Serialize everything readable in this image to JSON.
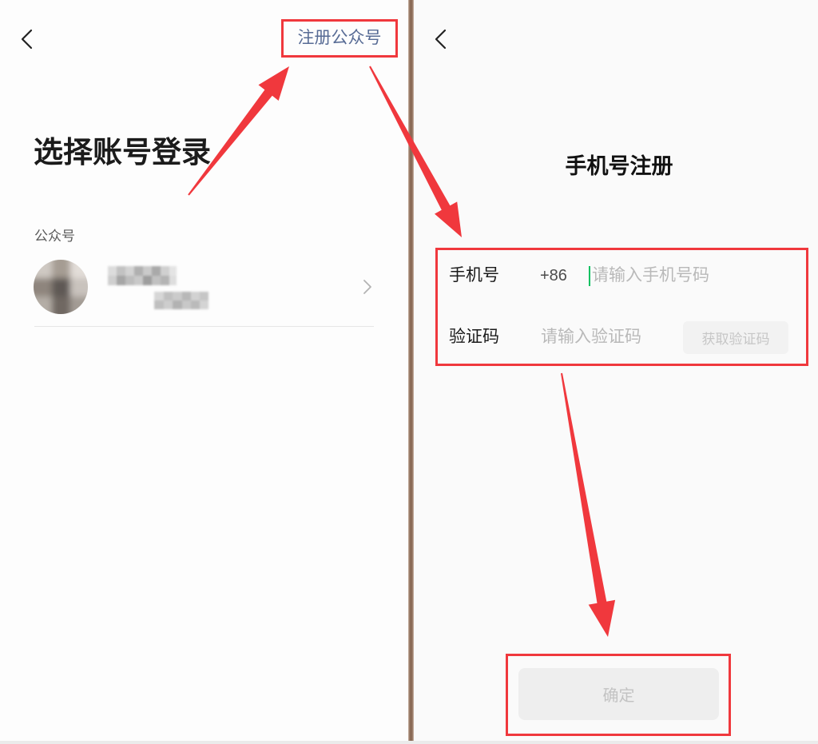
{
  "login_screen": {
    "back_icon": "chevron-left-icon",
    "register_link": "注册公众号",
    "title": "选择账号登录",
    "section_label": "公众号",
    "account_avatar_icon": "blurred-avatar",
    "account_chevron_icon": "chevron-right-icon"
  },
  "register_screen": {
    "back_icon": "chevron-left-icon",
    "title": "手机号注册",
    "phone": {
      "label": "手机号",
      "country_code": "+86",
      "placeholder": "请输入手机号码",
      "value": ""
    },
    "code": {
      "label": "验证码",
      "placeholder": "请输入验证码",
      "value": "",
      "get_code_button": "获取验证码"
    },
    "confirm_button": "确定"
  },
  "colors": {
    "annotation_red": "#f0383d",
    "link_blue": "#576b95",
    "cursor_green": "#07c160",
    "panel_divider": "#8b6b57",
    "disabled_button_bg": "#eeeeee",
    "disabled_button_text": "#c3c3c3",
    "placeholder_text": "#b9b9b9"
  }
}
